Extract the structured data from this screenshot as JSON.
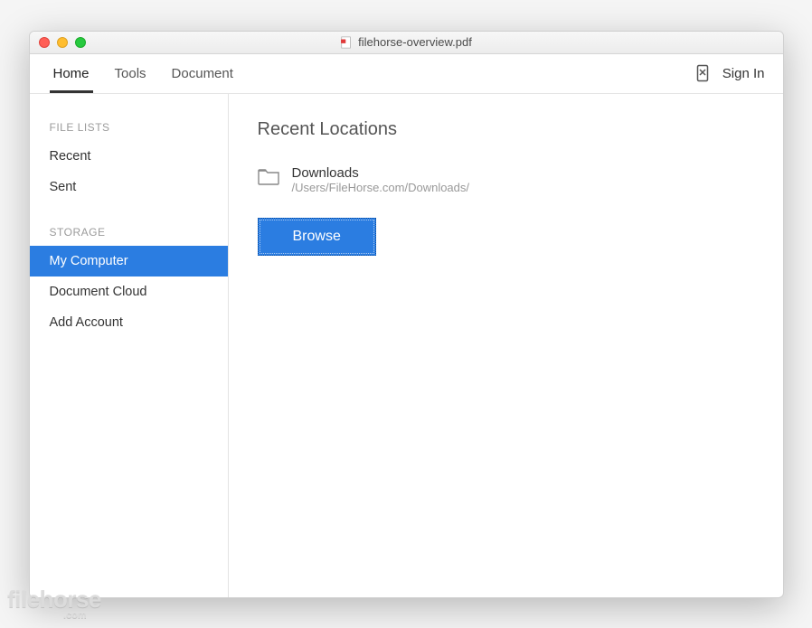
{
  "titlebar": {
    "title": "filehorse-overview.pdf"
  },
  "tabs": {
    "home": "Home",
    "tools": "Tools",
    "document": "Document",
    "signin": "Sign In"
  },
  "sidebar": {
    "file_lists_header": "FILE LISTS",
    "storage_header": "STORAGE",
    "items": {
      "recent": "Recent",
      "sent": "Sent",
      "my_computer": "My Computer",
      "document_cloud": "Document Cloud",
      "add_account": "Add Account"
    }
  },
  "main": {
    "heading": "Recent Locations",
    "location": {
      "name": "Downloads",
      "path": "/Users/FileHorse.com/Downloads/"
    },
    "browse_label": "Browse"
  },
  "watermark": {
    "text": "filehorse",
    "suffix": ".com"
  }
}
